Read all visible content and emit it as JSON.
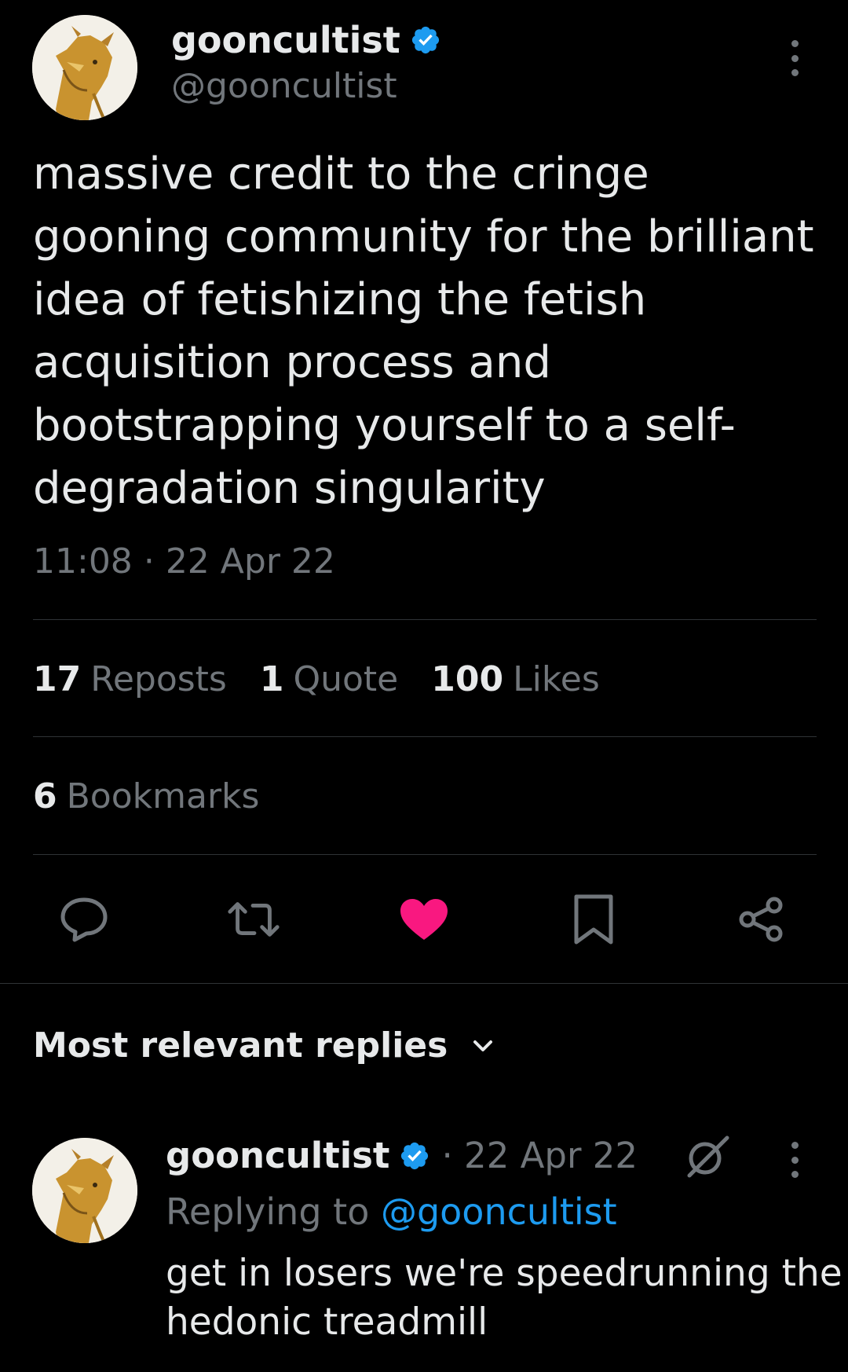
{
  "tweet": {
    "author": {
      "display_name": "gooncultist",
      "handle": "@gooncultist",
      "verified": true
    },
    "text": "massive credit to the cringe gooning community for the brilliant idea of fetishizing the fetish acquisition process and bootstrapping yourself to a self-degradation singularity",
    "time": "11:08",
    "separator": "·",
    "date": "22 Apr 22",
    "stats": {
      "reposts_count": "17",
      "reposts_label": "Reposts",
      "quotes_count": "1",
      "quotes_label": "Quote",
      "likes_count": "100",
      "likes_label": "Likes",
      "bookmarks_count": "6",
      "bookmarks_label": "Bookmarks"
    },
    "actions": [
      "reply-icon",
      "repost-icon",
      "like-icon",
      "bookmark-icon",
      "share-icon"
    ],
    "liked": true
  },
  "replies": {
    "title": "Most relevant replies",
    "items": [
      {
        "display_name": "gooncultist",
        "verified": true,
        "date": "· 22 Apr 22",
        "replying_label": "Replying to",
        "replying_handle": "@gooncultist",
        "text": "get in losers we're speedrunning the hedonic treadmill",
        "icon": "grok-icon"
      }
    ]
  },
  "colors": {
    "background": "#000000",
    "text": "#e7e9ea",
    "muted": "#71767b",
    "accent": "#1d9bf0",
    "like": "#f91880",
    "divider": "#2f3336"
  }
}
